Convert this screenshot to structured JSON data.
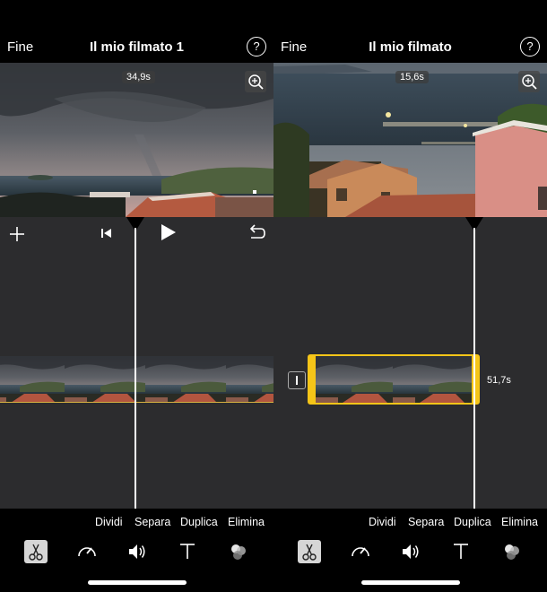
{
  "left": {
    "done_label": "Fine",
    "title": "Il mio filmato 1",
    "help_label": "?",
    "preview_time": "34,9s",
    "actions": [
      "Dividi",
      "Separa",
      "Duplica",
      "Elimina"
    ]
  },
  "right": {
    "done_label": "Fine",
    "title": "Il mio filmato",
    "help_label": "?",
    "preview_time": "15,6s",
    "clip_duration": "51,7s",
    "actions": [
      "Dividi",
      "Separa",
      "Duplica",
      "Elimina"
    ]
  },
  "colors": {
    "background": "#000000",
    "timeline": "#2c2c2e",
    "selection": "#f5c518",
    "tool_active": "#d6d6d6"
  },
  "icons": {
    "add": "plus-icon",
    "skip_back": "skip-to-start-icon",
    "play": "play-icon",
    "undo": "undo-icon",
    "zoom": "zoom-in-icon",
    "scissors": "scissors-icon",
    "speed": "speedometer-icon",
    "volume": "speaker-icon",
    "text": "text-icon",
    "filters": "filters-icon"
  }
}
